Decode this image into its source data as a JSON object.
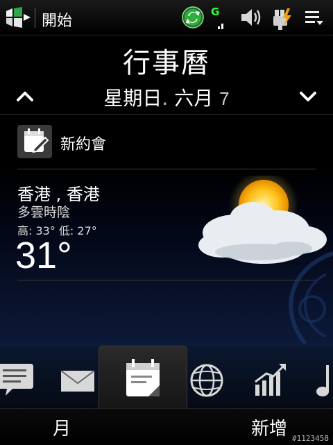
{
  "status_bar": {
    "start_label": "開始",
    "network_type": "G"
  },
  "app": {
    "title": "行事曆"
  },
  "date": {
    "day": "星期日",
    "separator": ".",
    "month": "六月",
    "number": "7"
  },
  "new_appointment": {
    "label": "新約會"
  },
  "weather": {
    "city": "香港 , 香港",
    "condition": "多雲時陰",
    "high_low": "高: 33° 低: 27°",
    "current_temp": "31°"
  },
  "tabs": [
    {
      "name": "messaging",
      "icon": "chat-icon"
    },
    {
      "name": "email",
      "icon": "envelope-icon"
    },
    {
      "name": "calendar",
      "icon": "calendar-icon",
      "active": true
    },
    {
      "name": "internet",
      "icon": "globe-icon"
    },
    {
      "name": "stocks",
      "icon": "chart-icon"
    },
    {
      "name": "music",
      "icon": "music-note-icon"
    }
  ],
  "softkeys": {
    "left": "月",
    "right": "新增"
  },
  "watermark": "#1123458",
  "colors": {
    "sync_green": "#2fae3f",
    "network_green": "#2cff2c",
    "battery_bolt": "#f2a000"
  }
}
